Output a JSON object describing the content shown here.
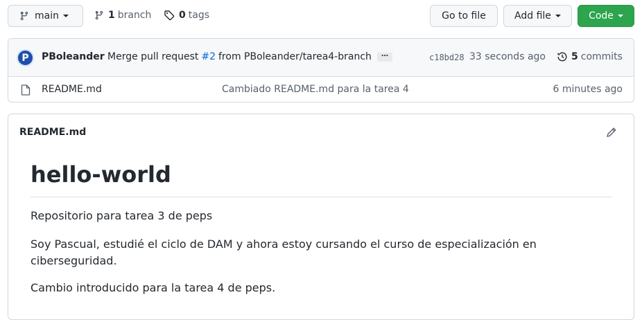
{
  "branch_selector": {
    "label": "main"
  },
  "branches": {
    "count": "1",
    "label": "branch"
  },
  "tags": {
    "count": "0",
    "label": "tags"
  },
  "actions": {
    "go_to_file": "Go to file",
    "add_file": "Add file",
    "code": "Code"
  },
  "commit": {
    "author": "PBoleander",
    "message_prefix": "Merge pull request",
    "pr_number": "#2",
    "message_suffix": "from PBoleander/tarea4-branch",
    "ellipsis": "…",
    "sha": "c18bd28",
    "time": "33 seconds ago",
    "commit_count": "5",
    "commits_label": "commits"
  },
  "files": [
    {
      "name": "README.md",
      "last_commit": "Cambiado README.md para la tarea 4",
      "time": "6 minutes ago"
    }
  ],
  "readme": {
    "header": "README.md",
    "title": "hello-world",
    "paragraphs": [
      "Repositorio para tarea 3 de peps",
      "Soy Pascual, estudié el ciclo de DAM y ahora estoy cursando el curso de especialización en ciberseguridad.",
      "Cambio introducido para la tarea 4 de peps."
    ]
  },
  "colors": {
    "code_button": "#2da44e",
    "link": "#0969da",
    "avatar": "#1f4fa8"
  },
  "icons": {
    "branch_selector": "git-branch-icon",
    "branches": "git-branch-icon",
    "tags": "tag-icon",
    "history": "history-icon",
    "file": "file-icon",
    "edit": "pencil-icon"
  }
}
